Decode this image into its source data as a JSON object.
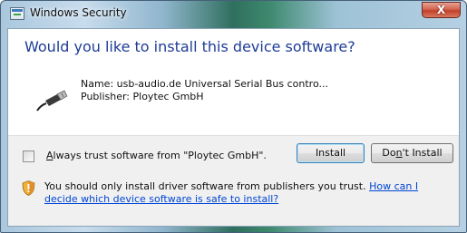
{
  "window": {
    "title": "Windows Security",
    "close_glyph": "X",
    "title_icon": "security-window-icon"
  },
  "dialog": {
    "heading": "Would you like to install this device software?",
    "device": {
      "icon": "usb-cable-icon",
      "name_line": "Name: usb-audio.de Universal Serial Bus contro...",
      "publisher_line": "Publisher: Ploytec GmbH"
    },
    "always_trust": {
      "checked": false,
      "access_key": "A",
      "label_rest": "lways trust software from \"Ploytec GmbH\"."
    },
    "buttons": {
      "install": "Install",
      "dont_install_prefix": "Do",
      "dont_install_key": "n",
      "dont_install_suffix": "'t Install"
    },
    "warning": {
      "icon": "shield-warning-icon",
      "text": "You should only install driver software from publishers you trust. ",
      "link": "How can I decide which device software is safe to install?"
    }
  },
  "colors": {
    "heading": "#1e3c96",
    "link": "#0046d5",
    "footer_bg": "#f0f0f0",
    "close_button": "#c2412a"
  }
}
